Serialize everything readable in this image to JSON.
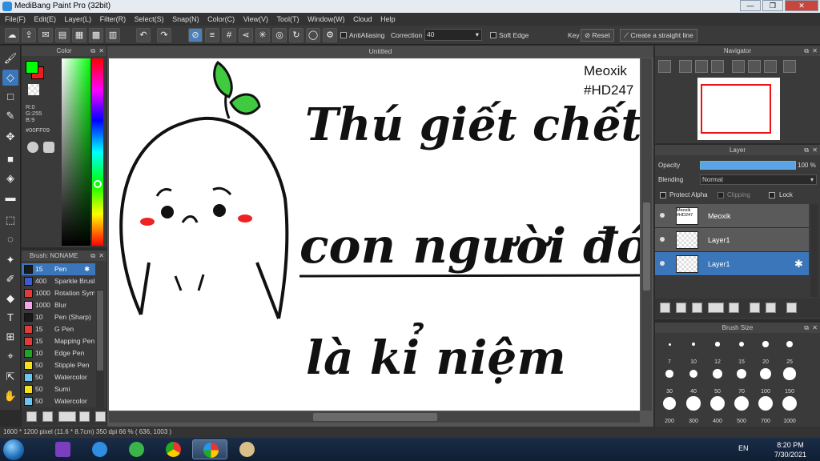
{
  "app": {
    "title": "MediBang Paint Pro (32bit)"
  },
  "window_controls": {
    "minimize": "—",
    "maximize": "❐",
    "close": "✕"
  },
  "menu": [
    "File(F)",
    "Edit(E)",
    "Layer(L)",
    "Filter(R)",
    "Select(S)",
    "Snap(N)",
    "Color(C)",
    "View(V)",
    "Tool(T)",
    "Window(W)",
    "Cloud",
    "Help"
  ],
  "toolbar": {
    "antialiasing_label": "AntiAliasing",
    "correction_label": "Correction",
    "correction_value": "40",
    "soft_edge_label": "Soft Edge",
    "key_label": "Key",
    "reset_label": "Reset",
    "straight_line_label": "Create a straight line"
  },
  "color_panel": {
    "title": "Color",
    "r": "R:0",
    "g": "G:255",
    "b": "B:9",
    "hex": "#00FF09",
    "fg_color": "#00ff09",
    "bg_color": "#e81f1f"
  },
  "brush_panel": {
    "title": "Brush: NONAME",
    "items": [
      {
        "size": "15",
        "name": "Pen",
        "color": "#1a1a1a"
      },
      {
        "size": "400",
        "name": "Sparkle Brush",
        "color": "#3b5bd6"
      },
      {
        "size": "1000",
        "name": "Rotation Sym",
        "color": "#e23b3b"
      },
      {
        "size": "1000",
        "name": "Blur",
        "color": "#f2a6e8"
      },
      {
        "size": "10",
        "name": "Pen (Sharp)",
        "color": "#1a1a1a"
      },
      {
        "size": "15",
        "name": "G Pen",
        "color": "#e23b3b"
      },
      {
        "size": "15",
        "name": "Mapping Pen",
        "color": "#e23b3b"
      },
      {
        "size": "10",
        "name": "Edge Pen",
        "color": "#1fa51f"
      },
      {
        "size": "50",
        "name": "Stipple Pen",
        "color": "#f2e21a"
      },
      {
        "size": "50",
        "name": "Watercolor",
        "color": "#6cc6f0"
      },
      {
        "size": "50",
        "name": "Sumi",
        "color": "#f2e21a"
      },
      {
        "size": "50",
        "name": "Watercolor",
        "color": "#6cc6f0"
      }
    ]
  },
  "canvas": {
    "tab_title": "Untitled",
    "signature_line1": "Meoxik",
    "signature_line2": "#HD247",
    "text_line1": "Thú giết chết",
    "text_line2": "con người đó",
    "text_line3": "là kỉ niệm"
  },
  "navigator": {
    "title": "Navigator"
  },
  "layer_panel": {
    "title": "Layer",
    "opacity_label": "Opacity",
    "opacity_value": "100 %",
    "opacity_fraction": 1.0,
    "blending_label": "Blending",
    "blending_value": "Normal",
    "protect_alpha": "Protect Alpha",
    "clipping": "Clipping",
    "lock": "Lock",
    "layers": [
      {
        "name": "Meoxik",
        "thumb_text": "Meoxik #HD247"
      },
      {
        "name": "Layer1",
        "thumb_text": ""
      },
      {
        "name": "Layer1",
        "thumb_text": ""
      }
    ]
  },
  "brush_size_panel": {
    "title": "Brush Size",
    "sizes": [
      "7",
      "10",
      "12",
      "15",
      "20",
      "25",
      "30",
      "40",
      "50",
      "70",
      "100",
      "150",
      "200",
      "300",
      "400",
      "500",
      "700",
      "1000"
    ]
  },
  "status": {
    "text": "1600 * 1200 pixel   (11.6 * 8.7cm)   350 dpi   66 %   ( 636, 1003 )"
  },
  "taskbar": {
    "lang": "EN",
    "time": "8:20 PM",
    "date": "7/30/2021"
  }
}
